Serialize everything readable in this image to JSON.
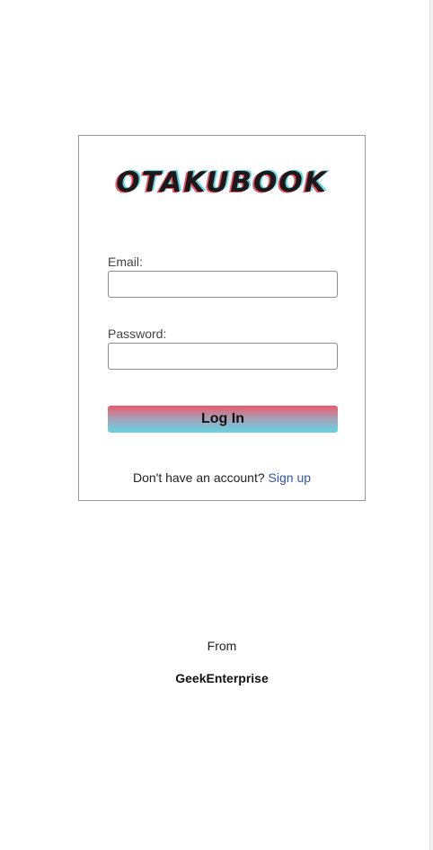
{
  "app": {
    "logo_text": "OTAKUBOOK"
  },
  "login_form": {
    "email_label": "Email:",
    "email_value": "",
    "password_label": "Password:",
    "password_value": "",
    "submit_label": "Log In",
    "signup_prompt": "Don't have an account?",
    "signup_link": "Sign up"
  },
  "footer": {
    "from_label": "From",
    "brand": "GeekEnterprise"
  },
  "colors": {
    "logo_shadow_red": "#f25468",
    "logo_shadow_cyan": "#5fd3e0",
    "button_gradient_top": "#ea5a6a",
    "button_gradient_bottom": "#64d5e3",
    "link": "#2f55b3",
    "card_border": "#9a9a9a"
  }
}
